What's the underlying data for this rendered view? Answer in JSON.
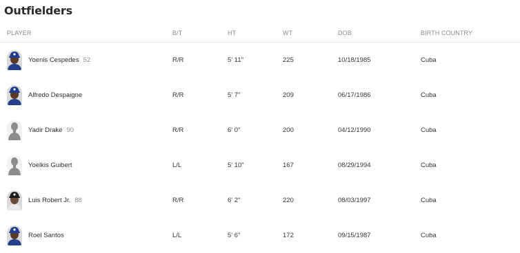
{
  "section": {
    "title": "Outfielders"
  },
  "table": {
    "headers": {
      "player": "PLAYER",
      "bt": "B/T",
      "ht": "Ht",
      "wt": "Wt",
      "dob": "DOB",
      "birth_country": "BIRTH COUNTRY"
    },
    "rows": [
      {
        "name": "Yoenis Cespedes",
        "number": "52",
        "bt": "R/R",
        "ht": "5' 11\"",
        "wt": "225",
        "dob": "10/18/1985",
        "country": "Cuba",
        "photo": "photo-cap-blue"
      },
      {
        "name": "Alfredo Despaigne",
        "number": "",
        "bt": "R/R",
        "ht": "5' 7\"",
        "wt": "209",
        "dob": "06/17/1986",
        "country": "Cuba",
        "photo": "photo-cap-blue"
      },
      {
        "name": "Yadir Drake",
        "number": "90",
        "bt": "R/R",
        "ht": "6' 0\"",
        "wt": "200",
        "dob": "04/12/1990",
        "country": "Cuba",
        "photo": "silhouette"
      },
      {
        "name": "Yoelkis Guibert",
        "number": "",
        "bt": "L/L",
        "ht": "5' 10\"",
        "wt": "167",
        "dob": "08/29/1994",
        "country": "Cuba",
        "photo": "silhouette"
      },
      {
        "name": "Luis Robert Jr.",
        "number": "88",
        "bt": "R/R",
        "ht": "6' 2\"",
        "wt": "220",
        "dob": "08/03/1997",
        "country": "Cuba",
        "photo": "photo-cap-black"
      },
      {
        "name": "Roel Santos",
        "number": "",
        "bt": "L/L",
        "ht": "5' 6\"",
        "wt": "172",
        "dob": "09/15/1987",
        "country": "Cuba",
        "photo": "photo-cap-blue"
      }
    ]
  }
}
